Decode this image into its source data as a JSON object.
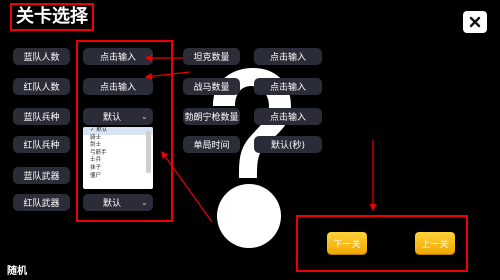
{
  "title": "关卡选择",
  "left_rows": [
    {
      "label": "蓝队人数",
      "kind": "input",
      "value": "点击输入"
    },
    {
      "label": "红队人数",
      "kind": "input",
      "value": "点击输入"
    },
    {
      "label": "蓝队兵种",
      "kind": "select",
      "value": "默认"
    },
    {
      "label": "红队兵种"
    },
    {
      "label": "蓝队武器"
    },
    {
      "label": "红队武器",
      "kind": "select",
      "value": "默认"
    }
  ],
  "dropdown_options": [
    "默认",
    "骑士",
    "剑士",
    "弓箭手",
    "士兵",
    "抹子",
    "僵尸"
  ],
  "right_rows": [
    {
      "label": "坦克数量",
      "value": "点击输入"
    },
    {
      "label": "战马数量",
      "value": "点击输入"
    },
    {
      "label": "勃朗宁枪数量",
      "value": "点击输入"
    },
    {
      "label": "单局时间",
      "value": "默认(秒)"
    }
  ],
  "buttons": {
    "next": "下一关",
    "prev": "上一关"
  },
  "footer": "随机",
  "colors": {
    "accent_red": "#e00000",
    "button_yellow": "#f5b800",
    "field_bg": "#2a2d38"
  }
}
